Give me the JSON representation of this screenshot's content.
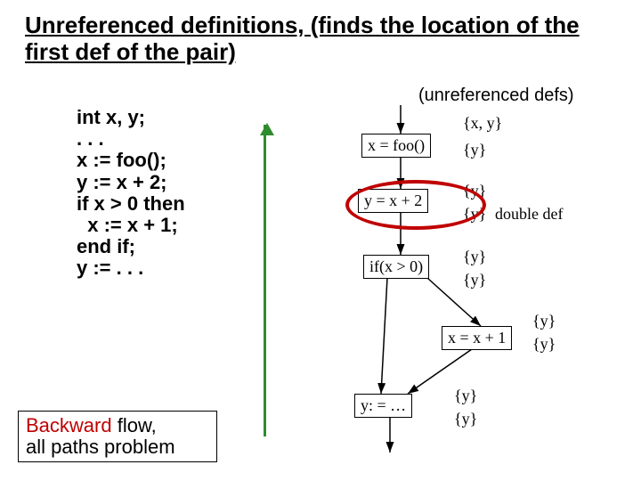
{
  "title": "Unreferenced definitions, (finds the location of the first def of the pair)",
  "subtitle": "(unreferenced defs)",
  "code": "int x, y;\n. . .\nx := foo();\ny := x + 2;\nif x > 0 then\n  x := x + 1;\nend if;\ny := . . .",
  "backward_line1_prefix": "Backward",
  "backward_line1_rest": " flow,",
  "backward_line2": "all paths problem",
  "nodes": {
    "n1": "x = foo()",
    "n2": "y = x + 2",
    "n3": "if(x > 0)",
    "n4": "x = x + 1",
    "n5": "y: = …"
  },
  "labels": {
    "n1_in": "{x, y}",
    "n1_out": "{y}",
    "n2_in": "{y}",
    "n2_out": "{y}",
    "n3_in": "{y}",
    "n3_out": "{y}",
    "n4_in": "{y}",
    "n4_out": "{y}",
    "n5_in": "{y}",
    "n5_out": "{y}"
  },
  "double_def": "double def",
  "chart_data": {
    "type": "diagram",
    "title": "Backward data-flow: unreferenced definitions",
    "nodes": [
      {
        "id": "n1",
        "label": "x = foo()",
        "in": "{x, y}",
        "out": "{y}"
      },
      {
        "id": "n2",
        "label": "y = x + 2",
        "in": "{y}",
        "out": "{y}",
        "annotation": "double def"
      },
      {
        "id": "n3",
        "label": "if(x > 0)",
        "in": "{y}",
        "out": "{y}"
      },
      {
        "id": "n4",
        "label": "x = x + 1",
        "in": "{y}",
        "out": "{y}"
      },
      {
        "id": "n5",
        "label": "y: = …",
        "in": "{y}",
        "out": "{y}"
      }
    ],
    "edges": [
      [
        "entry",
        "n1"
      ],
      [
        "n1",
        "n2"
      ],
      [
        "n2",
        "n3"
      ],
      [
        "n3",
        "n4"
      ],
      [
        "n3",
        "n5"
      ],
      [
        "n4",
        "n5"
      ]
    ]
  }
}
